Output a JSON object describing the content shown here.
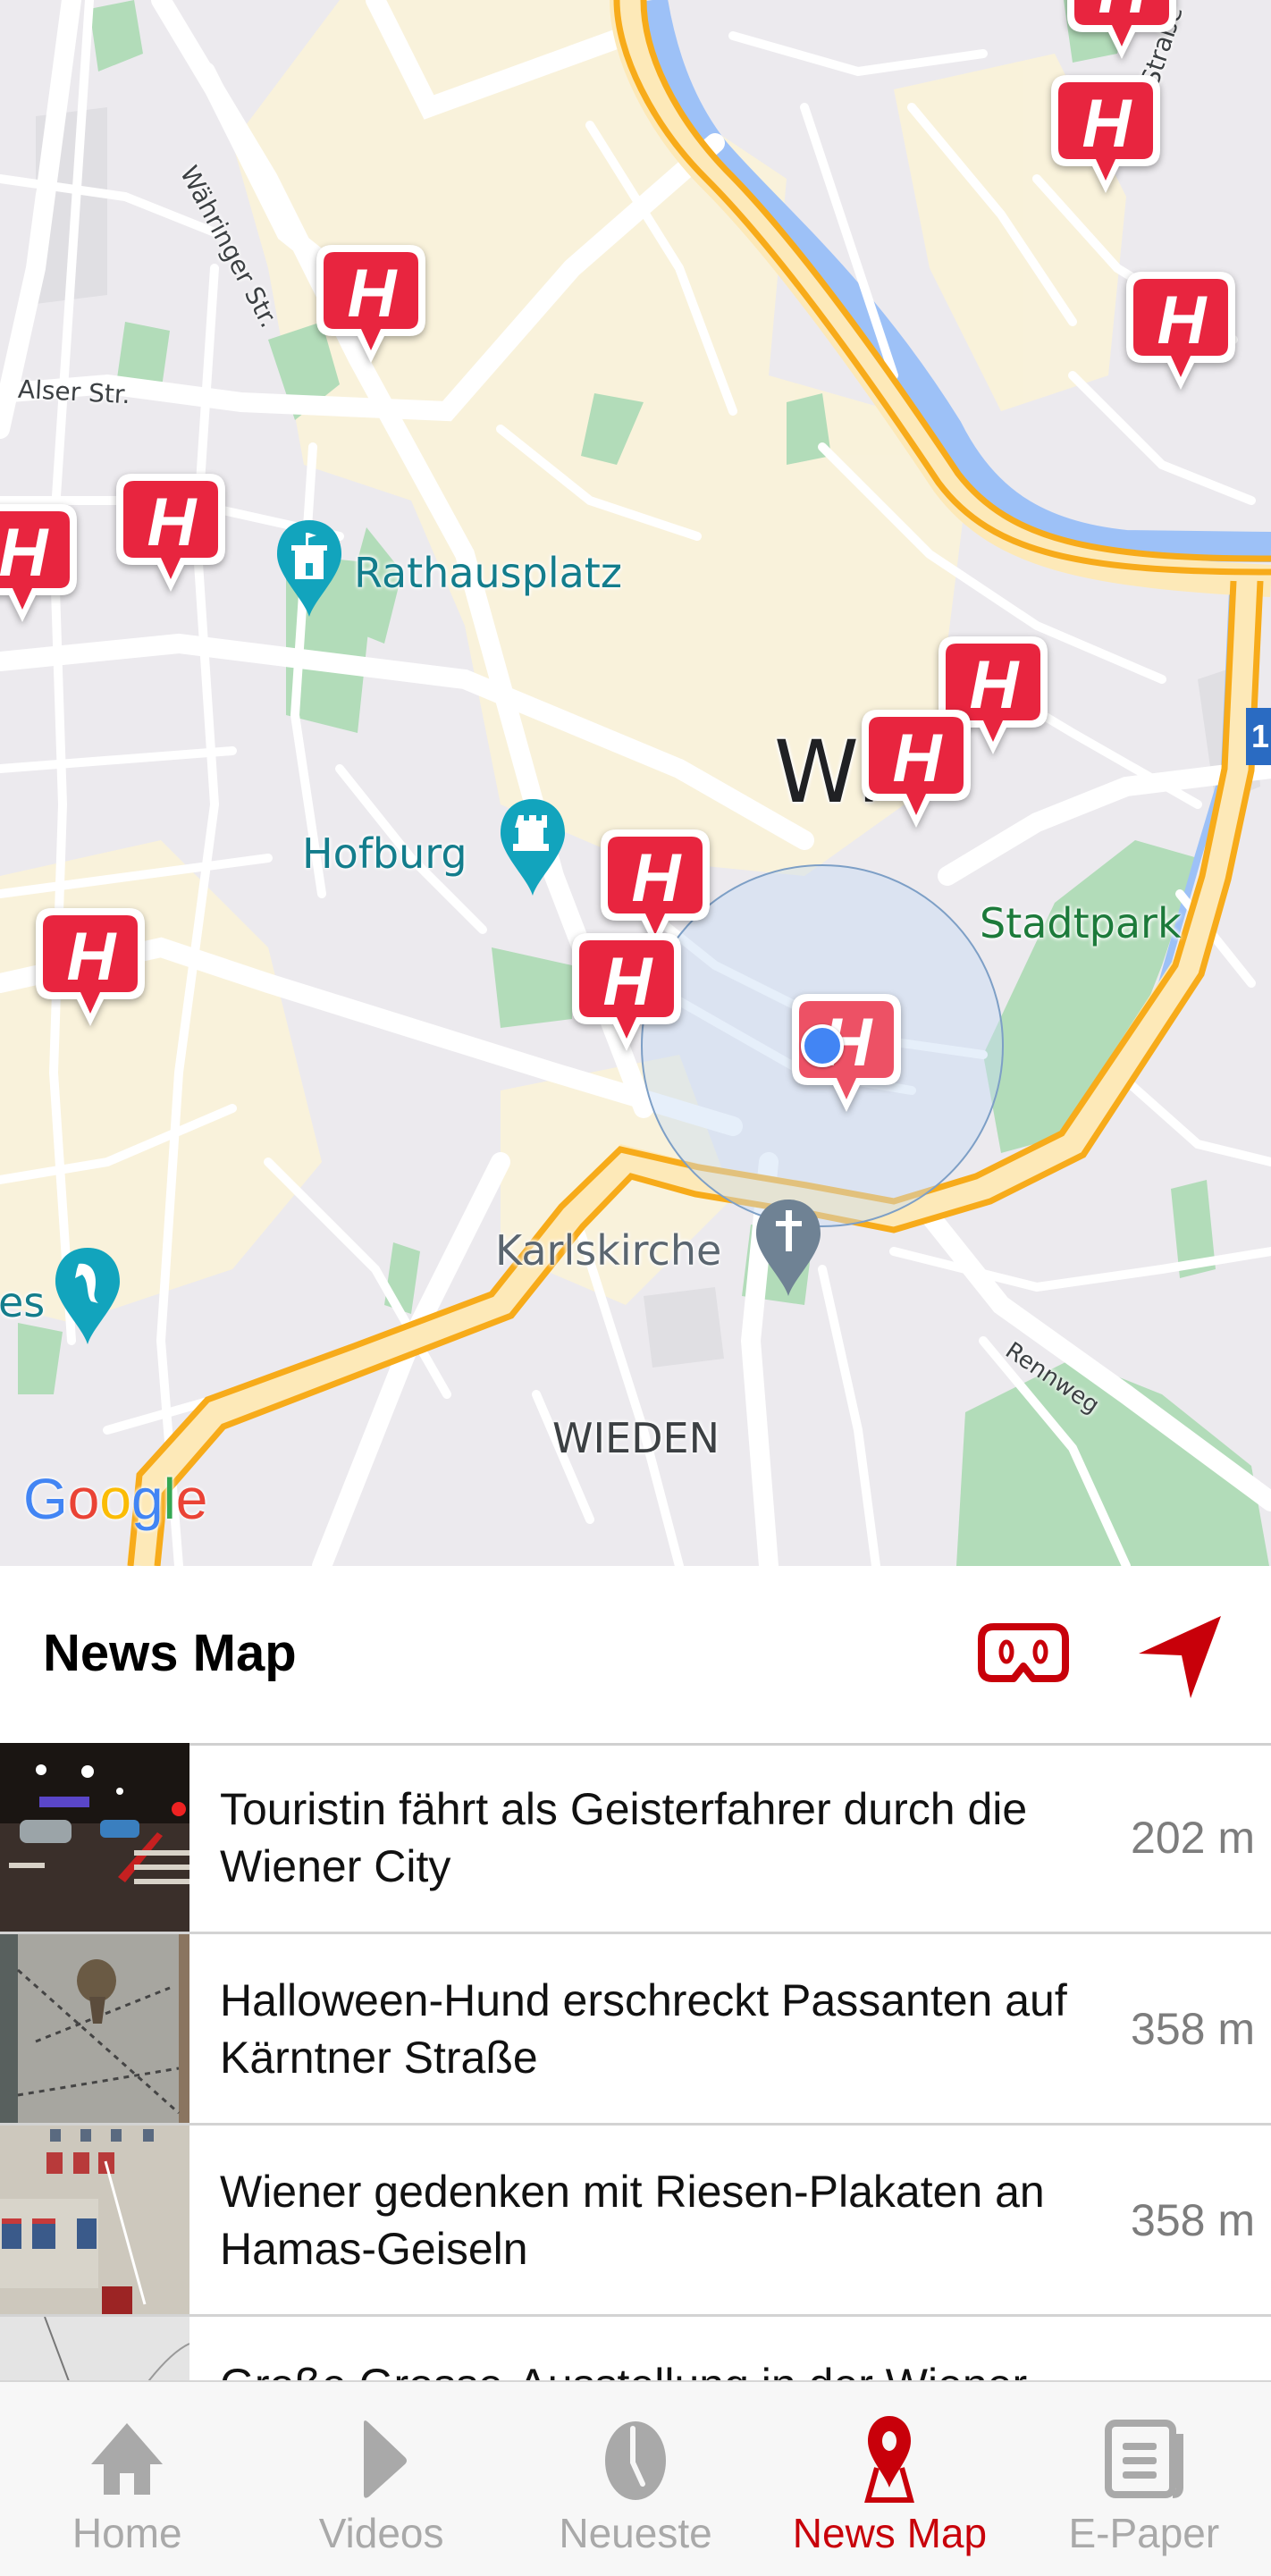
{
  "map": {
    "labels": {
      "waehringer": "Währinger Str.",
      "alser": "Alser Str.",
      "rathausplatz": "Rathausplatz",
      "hofburg": "Hofburg",
      "wien": "Wi",
      "stadtpark": "Stadtpark",
      "karlskirche": "Karlskirche",
      "wieden": "WIEDEN",
      "rennweg": "Rennweg",
      "strasse": "Straße",
      "es": "es",
      "route_sign": "1"
    },
    "attribution": {
      "letters": [
        "G",
        "o",
        "o",
        "g",
        "l",
        "e"
      ]
    },
    "marker_glyph": "H",
    "colors": {
      "marker": "#e8253f",
      "poi_teal": "#12a4bd",
      "park": "#b2dcb9",
      "water": "#9dc1f7",
      "highway": "#f7ab1a",
      "location_dot": "#4285f4"
    }
  },
  "header": {
    "title": "News Map",
    "vr_icon": "vr-glasses-icon",
    "location_icon": "navigation-arrow-icon",
    "accent": "#c8000a"
  },
  "list": {
    "items": [
      {
        "title": "Touristin fährt als Geisterfahrer durch die Wiener City",
        "distance": "202 m",
        "thumb": "night-street"
      },
      {
        "title": "Halloween-Hund erschreckt Passanten auf Kärntner Straße",
        "distance": "358 m",
        "thumb": "dog-pavement"
      },
      {
        "title": "Wiener gedenken mit Riesen-Plakaten an Hamas-Geiseln",
        "distance": "358 m",
        "thumb": "building-posters"
      },
      {
        "title": "Große Grosse-Ausstellung in der Wiener",
        "distance": "",
        "thumb": "gallery-ceiling"
      }
    ]
  },
  "nav": {
    "items": [
      {
        "label": "Home",
        "icon": "home-icon",
        "active": false
      },
      {
        "label": "Videos",
        "icon": "play-icon",
        "active": false
      },
      {
        "label": "Neueste",
        "icon": "clock-icon",
        "active": false
      },
      {
        "label": "News Map",
        "icon": "map-pin-icon",
        "active": true
      },
      {
        "label": "E-Paper",
        "icon": "newspaper-icon",
        "active": false
      }
    ]
  }
}
